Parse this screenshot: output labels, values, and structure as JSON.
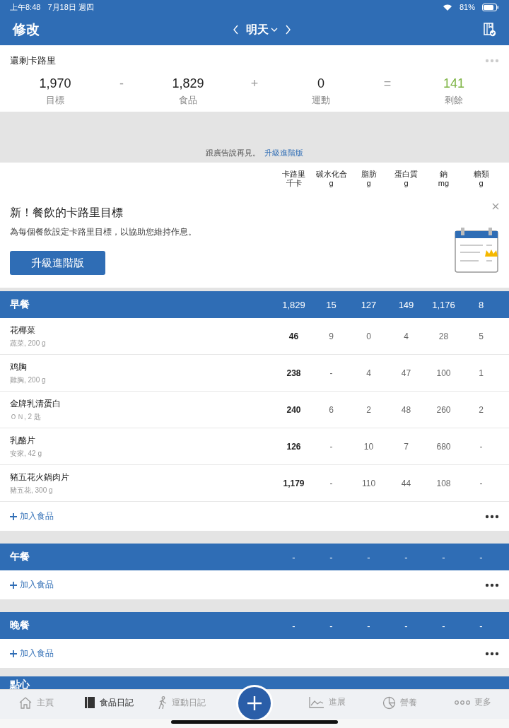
{
  "status_bar": {
    "time": "上午8:48",
    "date": "7月18日 週四",
    "battery_text": "81%"
  },
  "nav": {
    "edit": "修改",
    "day": "明天"
  },
  "summary": {
    "title": "還剩卡路里",
    "items": [
      {
        "value": "1,970",
        "label": "目標",
        "kind": "plain"
      },
      {
        "op": "-"
      },
      {
        "value": "1,829",
        "label": "食品",
        "kind": "plain"
      },
      {
        "op": "+"
      },
      {
        "value": "0",
        "label": "運動",
        "kind": "plain"
      },
      {
        "op": "="
      },
      {
        "value": "141",
        "label": "剩餘",
        "kind": "remaining"
      }
    ]
  },
  "ad_notice": {
    "text": "跟廣告說再見。",
    "link": "升級進階版"
  },
  "columns": [
    {
      "name": "卡路里",
      "unit": "千卡"
    },
    {
      "name": "碳水化合",
      "unit": "g"
    },
    {
      "name": "脂肪",
      "unit": "g"
    },
    {
      "name": "蛋白質",
      "unit": "g"
    },
    {
      "name": "鈉",
      "unit": "mg"
    },
    {
      "name": "糖類",
      "unit": "g"
    }
  ],
  "promo": {
    "title": "新！餐飲的卡路里目標",
    "text": "為每個餐飲設定卡路里目標，以協助您維持作息。",
    "button": "升級進階版"
  },
  "meals": [
    {
      "name": "早餐",
      "totals": [
        "1,829",
        "15",
        "127",
        "149",
        "1,176",
        "8"
      ],
      "add": "加入食品",
      "foods": [
        {
          "name": "花椰菜",
          "detail": "蔬菜, 200 g",
          "values": [
            "46",
            "9",
            "0",
            "4",
            "28",
            "5"
          ]
        },
        {
          "name": "鸡胸",
          "detail": "雞胸, 200 g",
          "values": [
            "238",
            "-",
            "4",
            "47",
            "100",
            "1"
          ]
        },
        {
          "name": "金牌乳清蛋白",
          "detail": "ＯＮ, 2 匙",
          "values": [
            "240",
            "6",
            "2",
            "48",
            "260",
            "2"
          ]
        },
        {
          "name": "乳酪片",
          "detail": "安家, 42 g",
          "values": [
            "126",
            "-",
            "10",
            "7",
            "680",
            "-"
          ]
        },
        {
          "name": "豬五花火鍋肉片",
          "detail": "豬五花, 300 g",
          "values": [
            "1,179",
            "-",
            "110",
            "44",
            "108",
            "-"
          ]
        }
      ]
    },
    {
      "name": "午餐",
      "totals": [
        "-",
        "-",
        "-",
        "-",
        "-",
        "-"
      ],
      "add": "加入食品"
    },
    {
      "name": "晚餐",
      "totals": [
        "-",
        "-",
        "-",
        "-",
        "-",
        "-"
      ],
      "add": "加入食品"
    },
    {
      "name": "點心"
    }
  ],
  "tab_bar": [
    {
      "label": "主頁",
      "kind": "home",
      "selected": false
    },
    {
      "label": "食品日記",
      "kind": "diary",
      "selected": true
    },
    {
      "label": "運動日記",
      "kind": "exercise",
      "selected": false
    },
    {
      "kind": "add",
      "selected": false
    },
    {
      "label": "進展",
      "kind": "progress",
      "selected": false
    },
    {
      "label": "營養",
      "kind": "nutrition",
      "selected": false
    },
    {
      "label": "更多",
      "kind": "more",
      "selected": false
    }
  ]
}
